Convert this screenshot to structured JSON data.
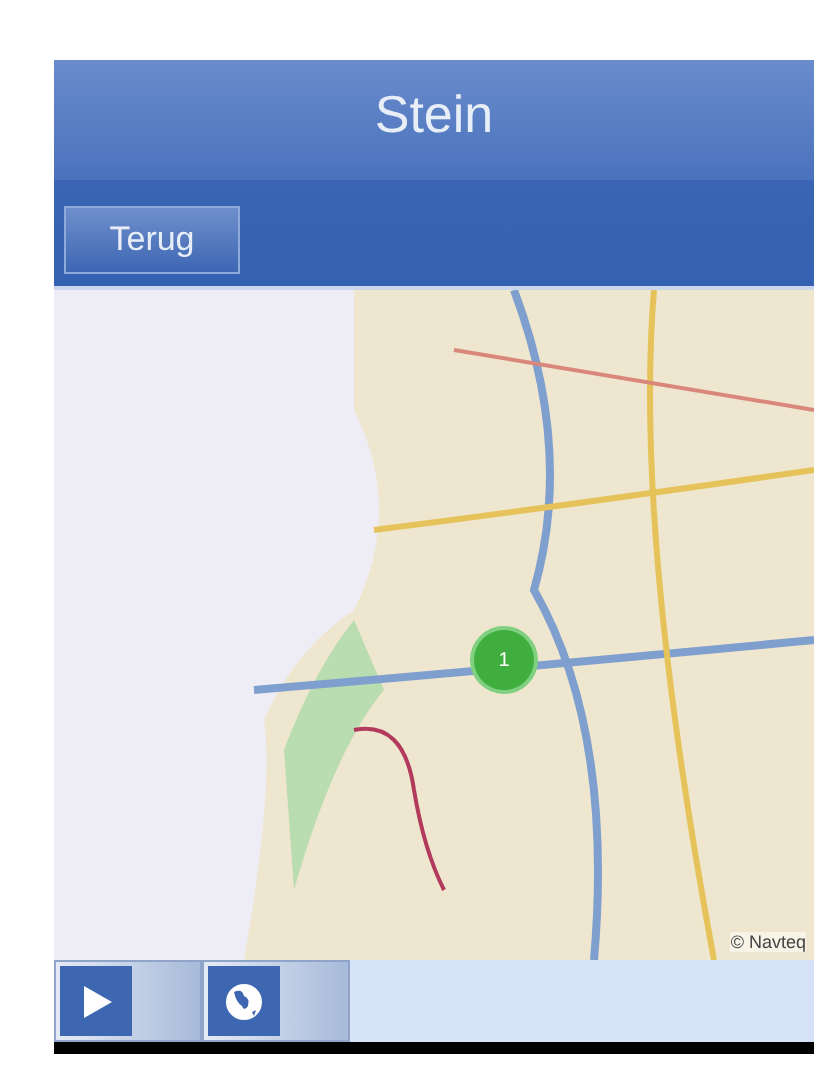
{
  "nav_bar": {
    "title": "Stein",
    "back_button": "Terug"
  },
  "map": {
    "cluster_marker": {
      "count": "1"
    },
    "attribution": "© Navteq"
  },
  "toolbar": {
    "buttons": [
      {
        "kind": "play"
      },
      {
        "kind": "globe"
      }
    ]
  }
}
